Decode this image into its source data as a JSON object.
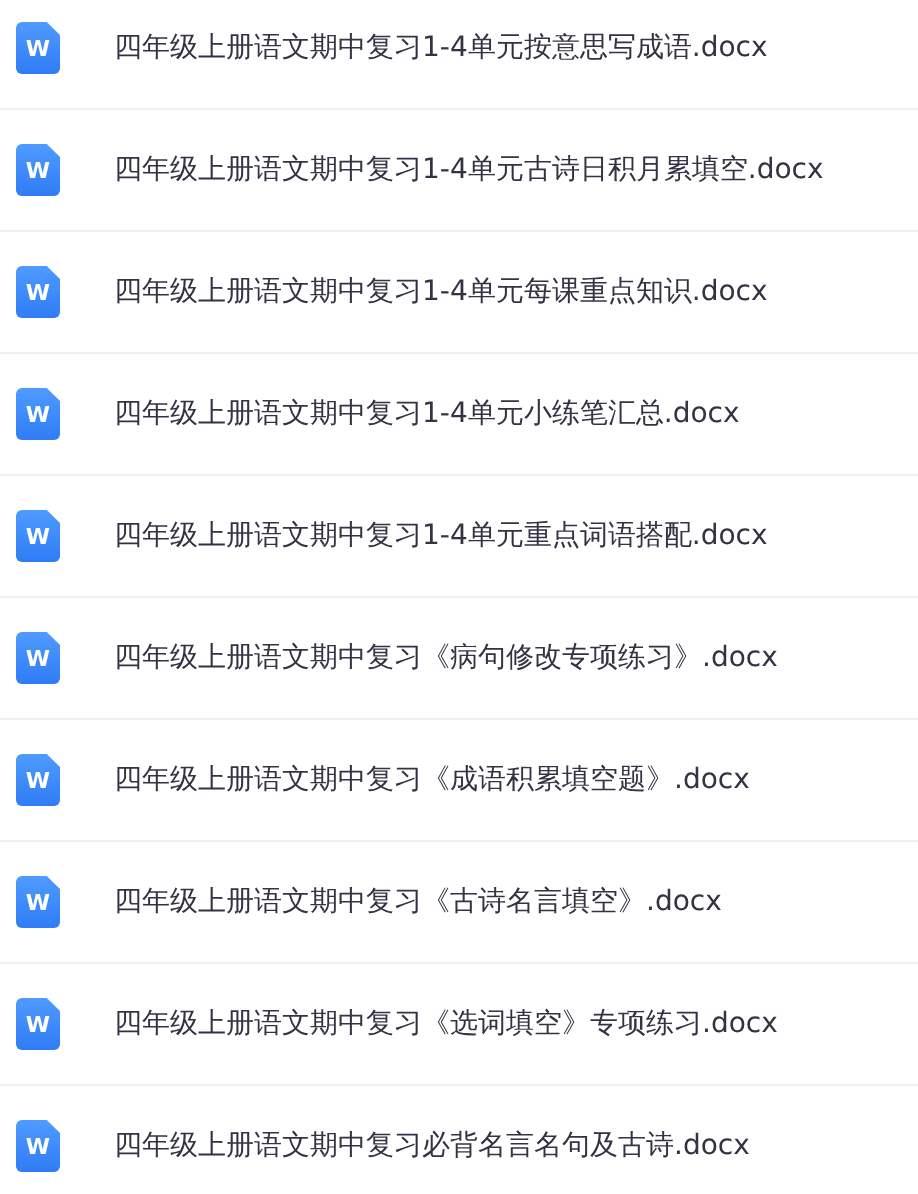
{
  "files": [
    {
      "name": "四年级上册语文期中复习1-4单元按意思写成语.docx",
      "icon_label": "W"
    },
    {
      "name": "四年级上册语文期中复习1-4单元古诗日积月累填空.docx",
      "icon_label": "W"
    },
    {
      "name": "四年级上册语文期中复习1-4单元每课重点知识.docx",
      "icon_label": "W"
    },
    {
      "name": "四年级上册语文期中复习1-4单元小练笔汇总.docx",
      "icon_label": "W"
    },
    {
      "name": "四年级上册语文期中复习1-4单元重点词语搭配.docx",
      "icon_label": "W"
    },
    {
      "name": "四年级上册语文期中复习《病句修改专项练习》.docx",
      "icon_label": "W"
    },
    {
      "name": "四年级上册语文期中复习《成语积累填空题》.docx",
      "icon_label": "W"
    },
    {
      "name": "四年级上册语文期中复习《古诗名言填空》.docx",
      "icon_label": "W"
    },
    {
      "name": "四年级上册语文期中复习《选词填空》专项练习.docx",
      "icon_label": "W"
    },
    {
      "name": "四年级上册语文期中复习必背名言名句及古诗.docx",
      "icon_label": "W"
    }
  ]
}
